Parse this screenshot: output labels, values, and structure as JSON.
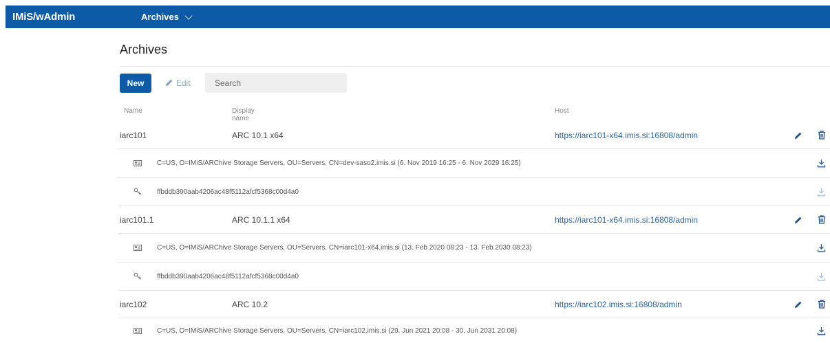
{
  "app": {
    "title": "IMiS/wAdmin"
  },
  "topnav": {
    "menu_label": "Archives"
  },
  "page": {
    "title": "Archives"
  },
  "toolbar": {
    "new_label": "New",
    "edit_label": "Edit",
    "search_placeholder": "Search"
  },
  "table": {
    "columns": {
      "name": "Name",
      "display_name": "Display name",
      "host": "Host"
    },
    "sorted_column": "display_name",
    "sort_direction": "ascending",
    "rows": [
      {
        "name": "iarc101",
        "display_name": "ARC 10.1 x64",
        "host": "https://iarc101-x64.imis.si:16808/admin",
        "certificate": "C=US, O=IMiS/ARChive Storage Servers, OU=Servers, CN=dev-saso2.imis.si (6. Nov 2019 16:25 - 6. Nov 2029 16:25)",
        "key": "ffbddb390aab4206ac48f5112afcf5368c00d4a0"
      },
      {
        "name": "iarc101.1",
        "display_name": "ARC 10.1.1 x64",
        "host": "https://iarc101-x64.imis.si:16808/admin",
        "certificate": "C=US, O=IMiS/ARChive Storage Servers, OU=Servers, CN=iarc101-x64.imis.si (13. Feb 2020 08:23 - 13. Feb 2030 08:23)",
        "key": "ffbddb390aab4206ac48f5112afcf5368c00d4a0"
      },
      {
        "name": "iarc102",
        "display_name": "ARC 10.2",
        "host": "https://iarc102.imis.si:16808/admin",
        "certificate": "C=US, O=IMiS/ARChive Storage Servers, OU=Servers, CN=iarc102.imis.si (29. Jun 2021 20:08 - 30. Jun 2031 20:08)"
      }
    ]
  },
  "colors": {
    "brand": "#0d5aa7",
    "link": "#2a62a0",
    "action_icon": "#1f4f8a",
    "disabled_icon": "#a9c3df"
  },
  "icons": [
    "chevron-down-icon",
    "pencil-icon",
    "trash-icon",
    "certificate-card-icon",
    "key-icon",
    "download-icon",
    "sort-up-arrow-icon"
  ]
}
